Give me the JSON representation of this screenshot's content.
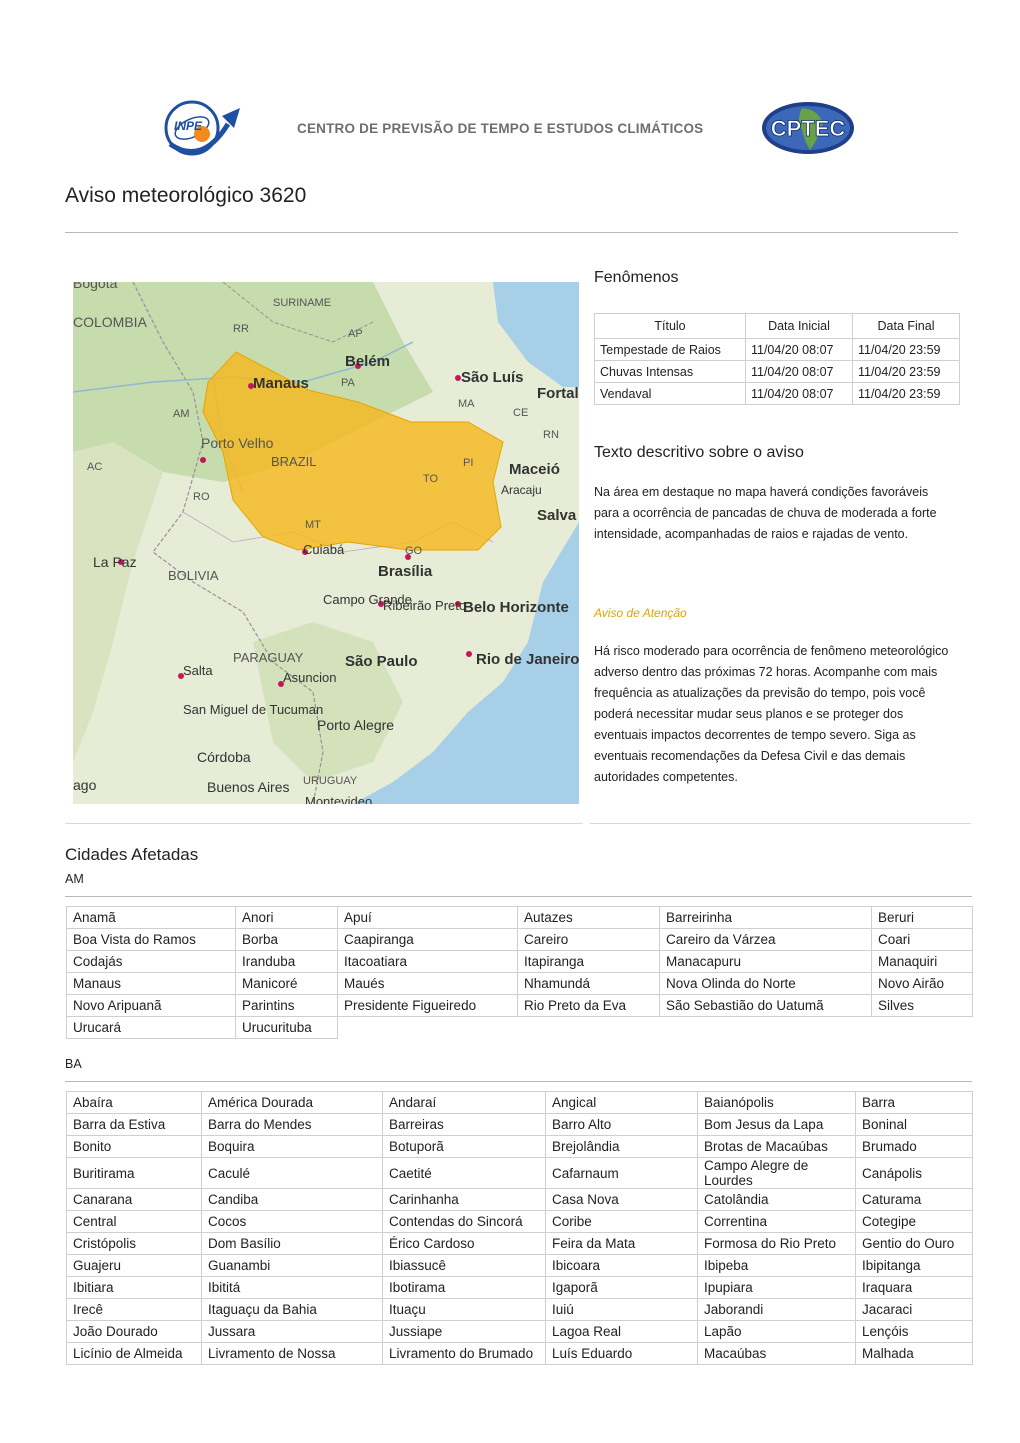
{
  "header": {
    "inpe_logo_text": "INPE",
    "title": "CENTRO DE PREVISÃO DE TEMPO E ESTUDOS CLIMÁTICOS",
    "cptec_logo_text": "CPTEC"
  },
  "page_title": "Aviso meteorológico 3620",
  "map": {
    "labels": [
      "Bogota",
      "SURINAME",
      "COLOMBIA",
      "RR",
      "AP",
      "Belém",
      "São Luís",
      "Fortal",
      "Manaus",
      "PA",
      "MA",
      "CE",
      "AM",
      "RN",
      "Porto Velho",
      "BRAZIL",
      "PI",
      "Maceió",
      "AC",
      "TO",
      "Aracaju",
      "RO",
      "Salva",
      "MT",
      "Cuiabá",
      "GO",
      "La Paz",
      "Brasília",
      "BOLIVIA",
      "Campo Grande",
      "Ribeirão Preto",
      "Belo Horizonte",
      "PARAGUAY",
      "São Paulo",
      "Rio de Janeiro",
      "Salta",
      "Asuncion",
      "San Miguel de Tucuman",
      "Porto Alegre",
      "Córdoba",
      "URUGUAY",
      "ago",
      "Buenos Aires",
      "Montevideo"
    ],
    "alert_color": "#f5b820"
  },
  "phenomena": {
    "heading": "Fenômenos",
    "columns": [
      "Título",
      "Data Inicial",
      "Data Final"
    ],
    "rows": [
      [
        "Tempestade de Raios",
        "11/04/20 08:07",
        "11/04/20 23:59"
      ],
      [
        "Chuvas Intensas",
        "11/04/20 08:07",
        "11/04/20 23:59"
      ],
      [
        "Vendaval",
        "11/04/20 08:07",
        "11/04/20 23:59"
      ]
    ]
  },
  "description": {
    "heading": "Texto descritivo sobre o aviso",
    "text": "Na área em destaque no mapa haverá condições favoráveis para a ocorrência de pancadas de chuva de moderada a forte intensidade, acompanhadas de raios e rajadas de vento.",
    "alert_label": "Aviso de Atenção",
    "alert_color": "#e0a400",
    "risk_text": "Há risco moderado para ocorrência de fenômeno meteorológico adverso dentro das próximas 72 horas. Acompanhe com mais frequência as atualizações da previsão do tempo, pois você poderá necessitar mudar seus planos e se proteger dos eventuais impactos decorrentes de tempo severo. Siga as eventuais recomendações da Defesa Civil e das demais autoridades competentes."
  },
  "cities": {
    "heading": "Cidades Afetadas",
    "states": [
      {
        "name": "AM",
        "rows": [
          [
            "Anamã",
            "Anori",
            "Apuí",
            "Autazes",
            "Barreirinha",
            "Beruri"
          ],
          [
            "Boa Vista do Ramos",
            "Borba",
            "Caapiranga",
            "Careiro",
            "Careiro da Várzea",
            "Coari"
          ],
          [
            "Codajás",
            "Iranduba",
            "Itacoatiara",
            "Itapiranga",
            "Manacapuru",
            "Manaquiri"
          ],
          [
            "Manaus",
            "Manicoré",
            "Maués",
            "Nhamundá",
            "Nova Olinda do Norte",
            "Novo Airão"
          ],
          [
            "Novo Aripuanã",
            "Parintins",
            "Presidente Figueiredo",
            "Rio Preto da Eva",
            "São Sebastião do Uatumã",
            "Silves"
          ],
          [
            "Urucará",
            "Urucurituba"
          ]
        ]
      },
      {
        "name": "BA",
        "rows": [
          [
            "Abaíra",
            "América Dourada",
            "Andaraí",
            "Angical",
            "Baianópolis",
            "Barra"
          ],
          [
            "Barra da Estiva",
            "Barra do Mendes",
            "Barreiras",
            "Barro Alto",
            "Bom Jesus da Lapa",
            "Boninal"
          ],
          [
            "Bonito",
            "Boquira",
            "Botuporã",
            "Brejolândia",
            "Brotas de Macaúbas",
            "Brumado"
          ],
          [
            "Buritirama",
            "Caculé",
            "Caetité",
            "Cafarnaum",
            "Campo Alegre de Lourdes",
            "Canápolis"
          ],
          [
            "Canarana",
            "Candiba",
            "Carinhanha",
            "Casa Nova",
            "Catolândia",
            "Caturama"
          ],
          [
            "Central",
            "Cocos",
            "Contendas do Sincorá",
            "Coribe",
            "Correntina",
            "Cotegipe"
          ],
          [
            "Cristópolis",
            "Dom Basílio",
            "Érico Cardoso",
            "Feira da Mata",
            "Formosa do Rio Preto",
            "Gentio do Ouro"
          ],
          [
            "Guajeru",
            "Guanambi",
            "Ibiassucê",
            "Ibicoara",
            "Ibipeba",
            "Ibipitanga"
          ],
          [
            "Ibitiara",
            "Ibititá",
            "Ibotirama",
            "Igaporã",
            "Ipupiara",
            "Iraquara"
          ],
          [
            "Irecê",
            "Itaguaçu da Bahia",
            "Ituaçu",
            "Iuiú",
            "Jaborandi",
            "Jacaraci"
          ],
          [
            "João Dourado",
            "Jussara",
            "Jussiape",
            "Lagoa Real",
            "Lapão",
            "Lençóis"
          ],
          [
            "Licínio de Almeida",
            "Livramento de Nossa",
            "Livramento do Brumado",
            "Luís Eduardo",
            "Macaúbas",
            "Malhada"
          ]
        ]
      }
    ]
  }
}
